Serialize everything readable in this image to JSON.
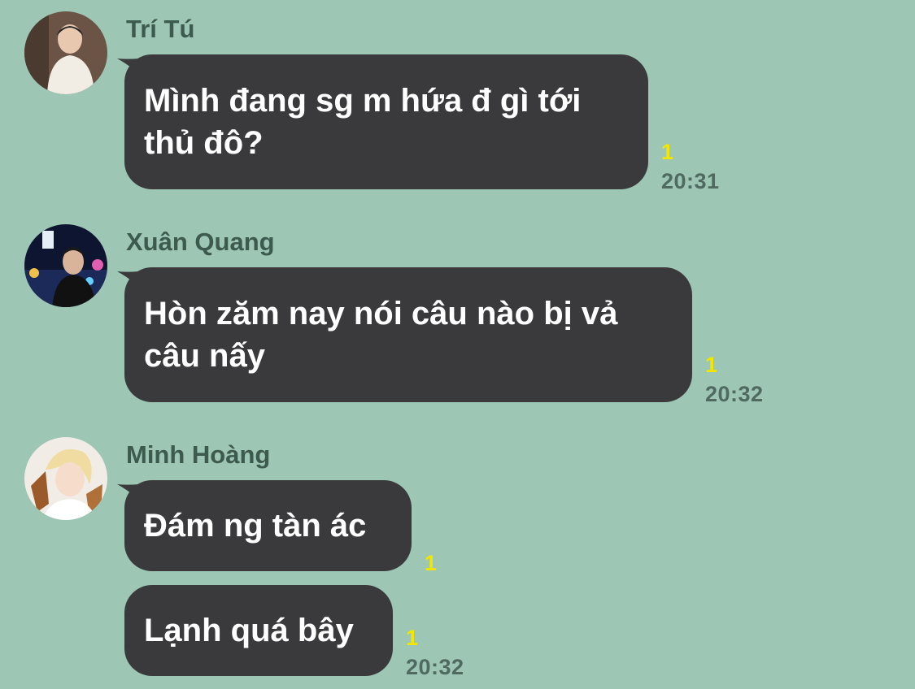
{
  "messages": [
    {
      "sender": "Trí Tú",
      "avatar_icon": "user-avatar-tritu",
      "lines": [
        "Mình đang sg m hứa đ gì tới",
        "thủ đô?"
      ],
      "read_count": "1",
      "time": "20:31"
    },
    {
      "sender": "Xuân Quang",
      "avatar_icon": "user-avatar-xuanquang",
      "lines": [
        "Hòn zăm nay nói câu nào bị vả",
        "câu nấy"
      ],
      "read_count": "1",
      "time": "20:32"
    },
    {
      "sender": "Minh Hoàng",
      "avatar_icon": "user-avatar-minhhoang",
      "lines": [
        "Đám ng tàn ác"
      ],
      "read_count": "1",
      "time": ""
    },
    {
      "sender": "",
      "lines": [
        "Lạnh quá bây"
      ],
      "read_count": "1",
      "time": "20:32"
    }
  ],
  "colors": {
    "background": "#9dc6b4",
    "bubble": "#3a3a3c",
    "bubble_text": "#ffffff",
    "read_receipt": "#f2e600",
    "meta_text": "#4f6a60"
  }
}
